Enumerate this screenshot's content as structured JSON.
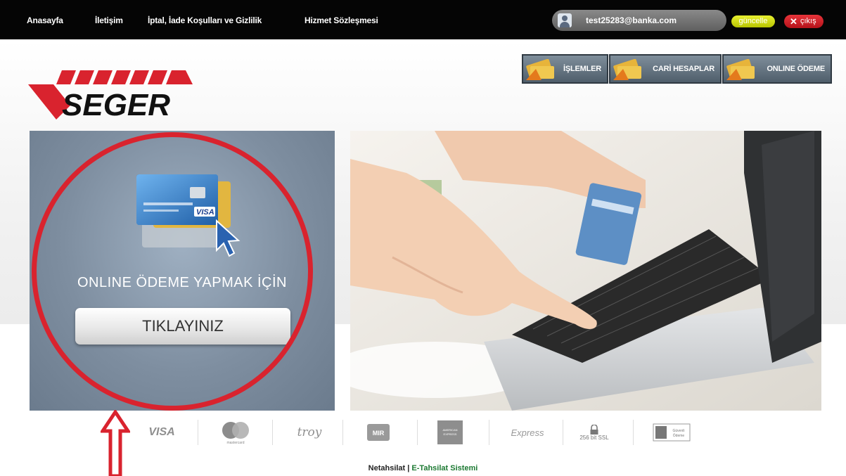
{
  "nav": {
    "items": [
      "Anasayfa",
      "İletişim",
      "İptal, İade Koşulları ve Gizlilik",
      "Hizmet Sözleşmesi"
    ]
  },
  "user": {
    "email": "test25283@banka.com",
    "update_label": "güncelle",
    "logout_label": "çıkış"
  },
  "brand": {
    "name": "SEGER"
  },
  "menu": {
    "items": [
      "İŞLEMLER",
      "CARİ HESAPLAR",
      "ONLINE ÖDEME"
    ]
  },
  "promo": {
    "heading": "ONLINE ÖDEME YAPMAK İÇİN",
    "button_label": "TIKLAYINIZ"
  },
  "payment_logos": [
    "VISA",
    "mastercard",
    "troy",
    "MIR",
    "AMERICAN EXPRESS",
    "Express",
    "256 bit SSL",
    "Güvenli Ödeme"
  ],
  "footer": {
    "brand": "Netahsilat",
    "separator": " | ",
    "tagline": "E-Tahsilat Sistemi"
  },
  "colors": {
    "topbar": "#050505",
    "accent_red": "#d9232e",
    "panel": "#7e8ea0",
    "update_yellow": "#c8d400",
    "footer_green": "#1d7a33"
  }
}
